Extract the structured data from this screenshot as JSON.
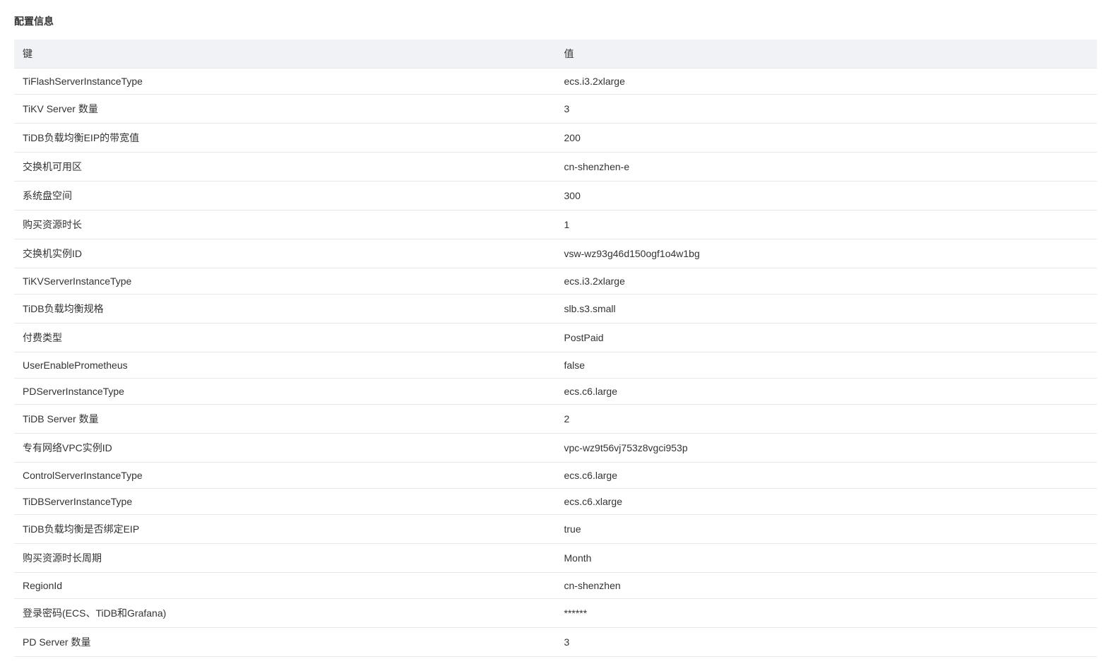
{
  "section": {
    "title": "配置信息"
  },
  "table": {
    "headers": {
      "key": "键",
      "value": "值"
    },
    "rows": [
      {
        "key": "TiFlashServerInstanceType",
        "value": "ecs.i3.2xlarge"
      },
      {
        "key": "TiKV Server 数量",
        "value": "3"
      },
      {
        "key": "TiDB负载均衡EIP的带宽值",
        "value": "200"
      },
      {
        "key": "交换机可用区",
        "value": "cn-shenzhen-e"
      },
      {
        "key": "系统盘空间",
        "value": "300"
      },
      {
        "key": "购买资源时长",
        "value": "1"
      },
      {
        "key": "交换机实例ID",
        "value": "vsw-wz93g46d150ogf1o4w1bg"
      },
      {
        "key": "TiKVServerInstanceType",
        "value": "ecs.i3.2xlarge"
      },
      {
        "key": "TiDB负载均衡规格",
        "value": "slb.s3.small"
      },
      {
        "key": "付费类型",
        "value": "PostPaid"
      },
      {
        "key": "UserEnablePrometheus",
        "value": "false"
      },
      {
        "key": "PDServerInstanceType",
        "value": "ecs.c6.large"
      },
      {
        "key": "TiDB Server 数量",
        "value": "2"
      },
      {
        "key": "专有网络VPC实例ID",
        "value": "vpc-wz9t56vj753z8vgci953p"
      },
      {
        "key": "ControlServerInstanceType",
        "value": "ecs.c6.large"
      },
      {
        "key": "TiDBServerInstanceType",
        "value": "ecs.c6.xlarge"
      },
      {
        "key": "TiDB负载均衡是否绑定EIP",
        "value": "true"
      },
      {
        "key": "购买资源时长周期",
        "value": "Month"
      },
      {
        "key": "RegionId",
        "value": "cn-shenzhen"
      },
      {
        "key": "登录密码(ECS、TiDB和Grafana)",
        "value": "******"
      },
      {
        "key": "PD Server 数量",
        "value": "3"
      }
    ]
  }
}
